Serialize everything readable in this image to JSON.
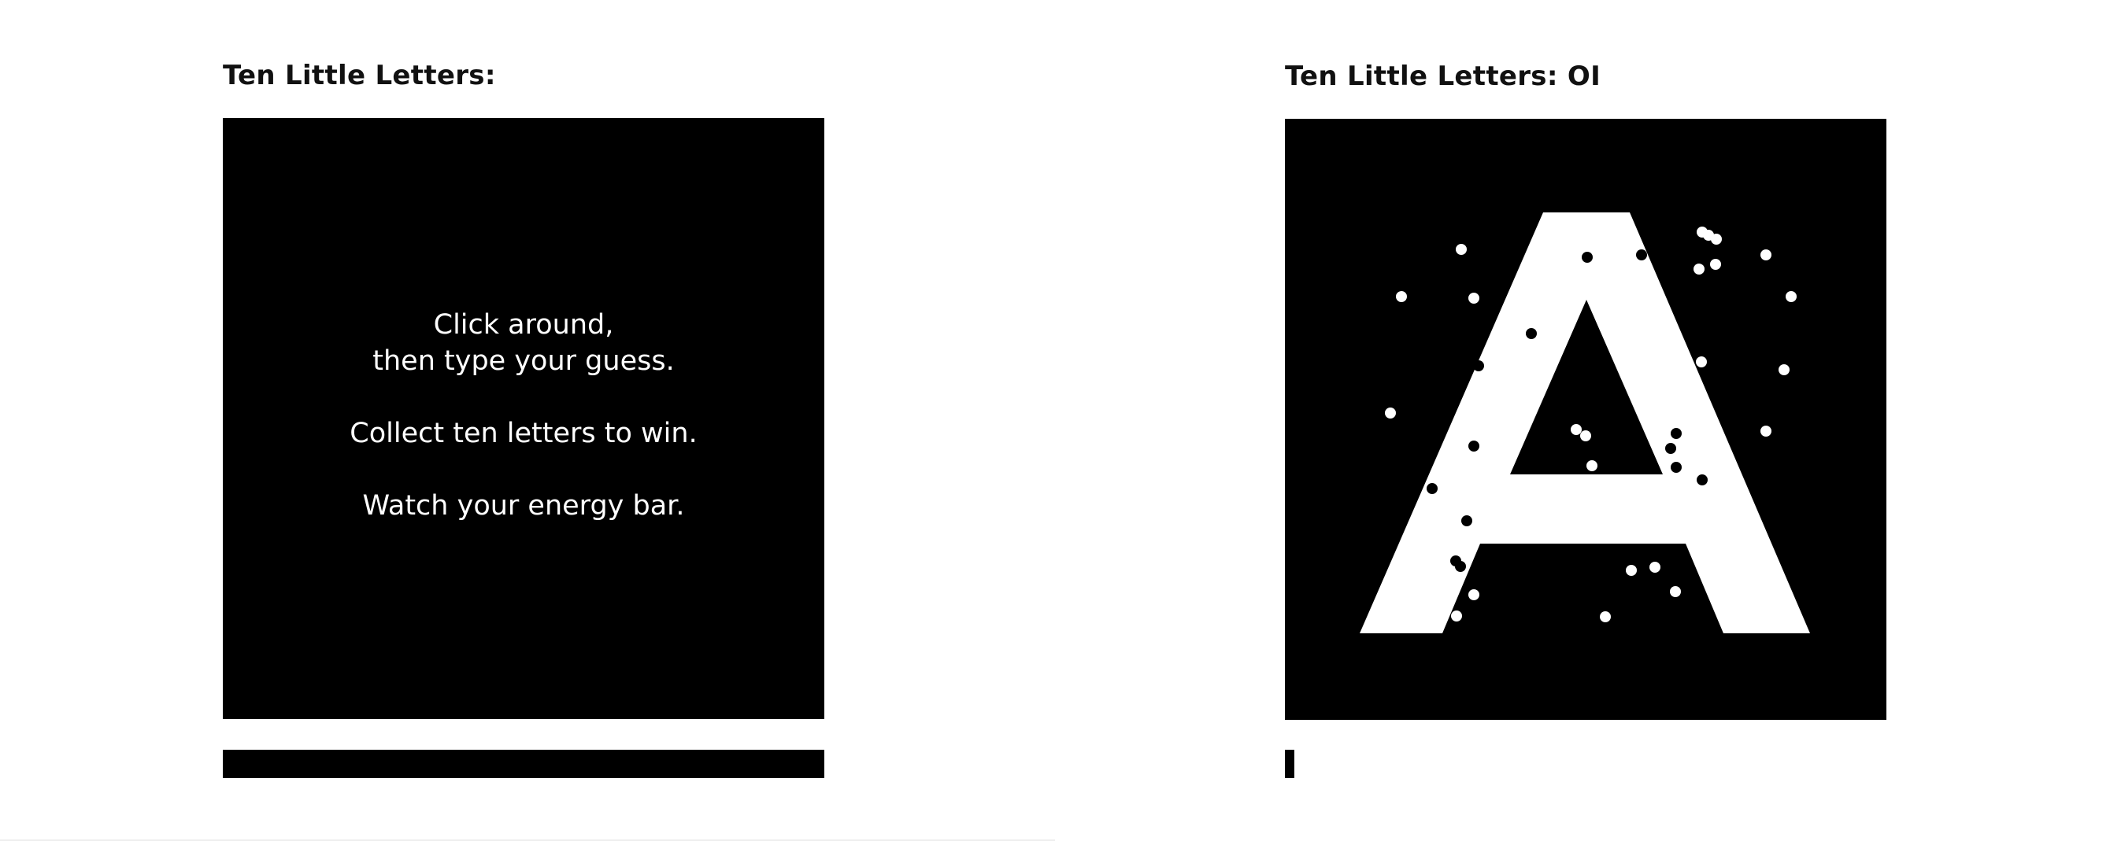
{
  "panels": [
    {
      "title": "Ten Little Letters:",
      "instructions": [
        "Click around,",
        "then type your guess.",
        "Collect ten letters to win.",
        "Watch your energy bar."
      ],
      "energy": 1.0
    },
    {
      "title": "Ten Little Letters: OI",
      "revealed_letter": "A",
      "energy": 0.015
    }
  ],
  "colors": {
    "background": "#ffffff",
    "board": "#000000",
    "letter": "#ffffff",
    "text": "#111111"
  }
}
